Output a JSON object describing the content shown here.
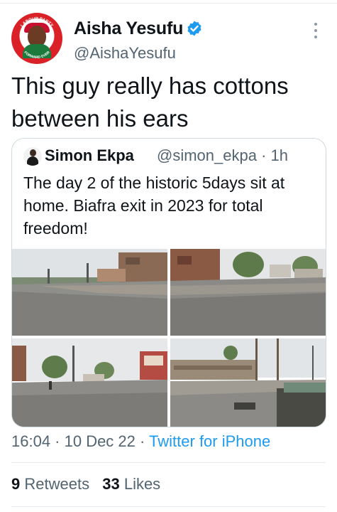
{
  "author": {
    "name": "Aisha Yesufu",
    "handle": "@AishaYesufu",
    "avatar_icon": "party-logo-avatar",
    "verified_icon": "verified-badge-icon",
    "verified_color": "#1d9bf0"
  },
  "avatar_ring_text": {
    "top": "LABOUR PARTY",
    "bottom": "FORWARD EVER"
  },
  "tweet": {
    "text": "This guy really has cottons between his ears"
  },
  "quoted_tweet": {
    "author_name": "Simon Ekpa",
    "handle_time": "@simon_ekpa · 1h",
    "text": "The day 2 of the historic 5days sit at home. Biafra exit in 2023 for total freedom!",
    "photos": [
      "empty-street-photo-1",
      "empty-street-photo-2",
      "empty-street-photo-3",
      "empty-street-photo-4"
    ]
  },
  "meta": {
    "timestamp": "16:04 · 10 Dec 22 · ",
    "source": "Twitter for iPhone"
  },
  "stats": {
    "retweets_count": "9",
    "retweets_label": "Retweets",
    "likes_count": "33",
    "likes_label": "Likes"
  },
  "colors": {
    "link": "#1d9bf0",
    "secondary_text": "#536471",
    "border": "#cfd9de"
  }
}
